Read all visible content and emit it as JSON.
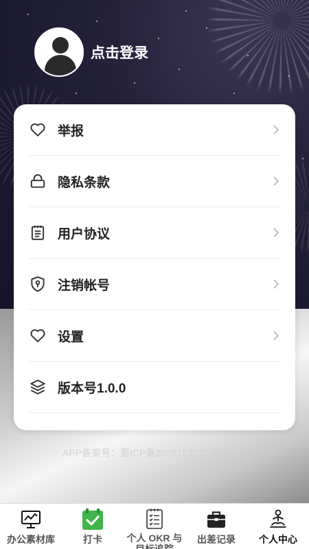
{
  "profile": {
    "login_label": "点击登录"
  },
  "menu": {
    "items": [
      {
        "label": "举报",
        "icon": "heart-icon"
      },
      {
        "label": "隐私条款",
        "icon": "lock-icon"
      },
      {
        "label": "用户协议",
        "icon": "clipboard-icon"
      },
      {
        "label": "注销帐号",
        "icon": "shield-icon"
      },
      {
        "label": "设置",
        "icon": "heart-icon"
      },
      {
        "label": "版本号1.0.0",
        "icon": "layers-icon"
      }
    ]
  },
  "footer": {
    "icp_text": "APP备案号：蜀ICP备2025153020号-71A >"
  },
  "tabbar": {
    "tabs": [
      {
        "label": "办公素材库",
        "icon": "chart-board-icon"
      },
      {
        "label": "打卡",
        "icon": "check-icon"
      },
      {
        "label": "个人 OKR 与目标追踪",
        "icon": "checklist-icon"
      },
      {
        "label": "出差记录",
        "icon": "briefcase-icon"
      },
      {
        "label": "个人中心",
        "icon": "meditation-icon"
      }
    ],
    "active_index": 4
  },
  "colors": {
    "accent_green": "#3fb54a",
    "text_dark": "#222222"
  }
}
